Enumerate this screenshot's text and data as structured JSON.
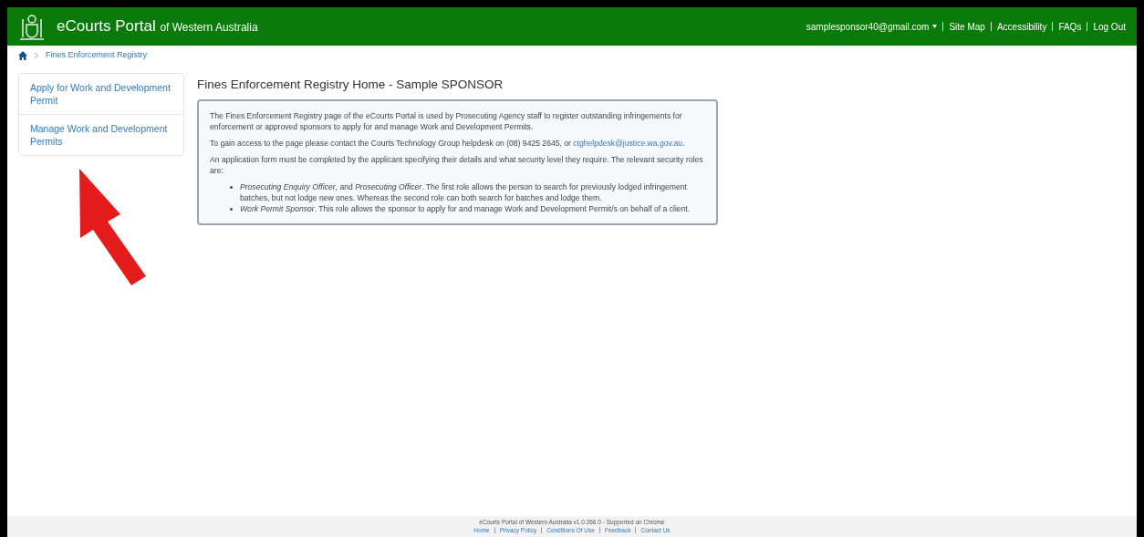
{
  "header": {
    "title": "eCourts Portal",
    "subtitle": "of Western Australia",
    "user": "samplesponsor40@gmail.com",
    "links": [
      "Site Map",
      "Accessibility",
      "FAQs",
      "Log Out"
    ]
  },
  "breadcrumb": [
    "Fines Enforcement Registry"
  ],
  "sidebar": {
    "items": [
      {
        "label": "Apply for Work and Development Permit"
      },
      {
        "label": "Manage Work and Development Permits"
      }
    ]
  },
  "main": {
    "title": "Fines Enforcement Registry Home - Sample SPONSOR",
    "paragraphs": [
      "The Fines Enforcement Registry page of the eCourts Portal is used by Prosecuting Agency staff to register outstanding infringements for enforcement or approved sponsors to apply for and manage Work and Development Permits."
    ],
    "contact": {
      "text": "To gain access to the page please contact the Courts Technology Group helpdesk on (08) 9425 2645, or",
      "email": "ctghelpdesk@justice.wa.gov.au",
      "after": "."
    },
    "roles_intro": "An application form must be completed by the applicant specifying their details and what security level they require. The relevant security roles are:",
    "roles": [
      "*Prosecuting Enquiry Officer*, and *Prosecuting Officer*. The first role allows the person to search for previously lodged infringement batches, but not lodge new ones. Whereas the second role can both search for batches and lodge them.",
      "*Work Permit Sponsor*. This role allows the sponsor to apply for and manage Work and Development Permit/s on behalf of a client."
    ]
  },
  "footer": {
    "text": "eCourts Portal of Western Australia v1.0.266.0 - Supported on Chrome",
    "links": [
      "Home",
      "Privacy Policy",
      "Conditions Of Use",
      "Feedback",
      "Contact Us"
    ]
  }
}
